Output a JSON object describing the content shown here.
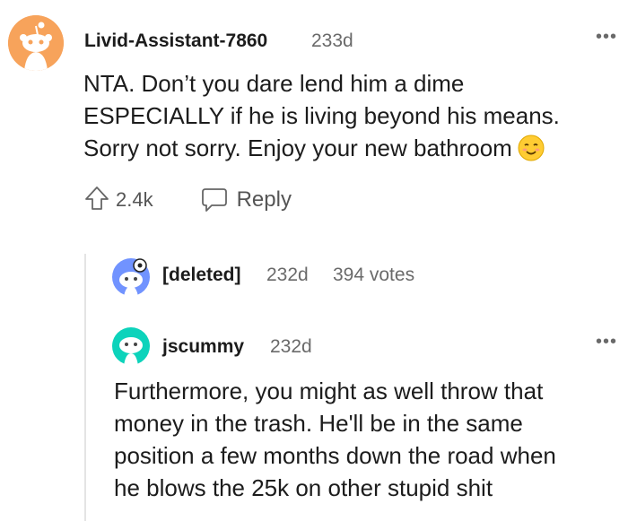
{
  "top_comment": {
    "username": "Livid-Assistant-7860",
    "age": "233d",
    "more_label": "•••",
    "lines": [
      "NTA. Don’t you dare lend him a dime",
      "ESPECIALLY if he is living beyond his means.",
      "Sorry not sorry. Enjoy your new bathroom"
    ],
    "upvotes": "2.4k",
    "reply_label": "Reply"
  },
  "deleted_comment": {
    "username": "[deleted]",
    "age": "232d",
    "votes": "394 votes"
  },
  "reply_comment": {
    "username": "jscummy",
    "age": "232d",
    "more_label": "•••",
    "lines": [
      "Furthermore, you might as well throw that",
      "money in the trash. He'll be in the same",
      "position a few months down the road when",
      "he blows the 25k on other stupid shit"
    ]
  },
  "colors": {
    "avatar_top_bg": "#f7a35b",
    "meta_text": "#6a6a6a",
    "thread_line": "#e4e4e4",
    "avatar_reply_bg": "#0dd3bb",
    "avatar_deleted_bg": "#7193ff"
  },
  "icons": {
    "upvote": "upvote-arrow-icon",
    "reply": "speech-bubble-icon",
    "emoji": "smiling-face-emoji",
    "avatar": "snoo-avatar-icon"
  }
}
